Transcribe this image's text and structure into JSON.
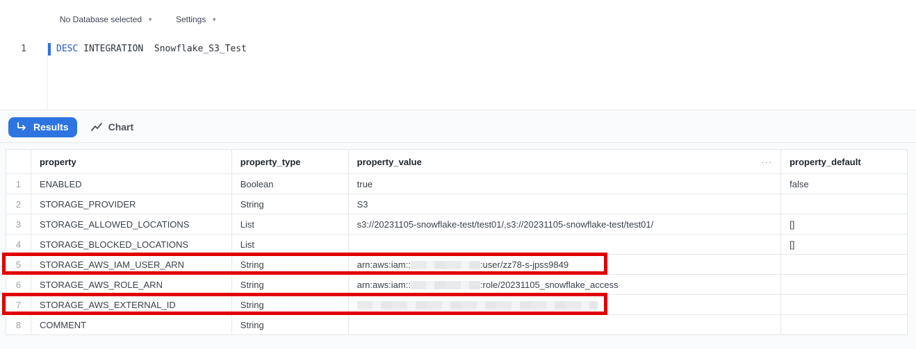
{
  "toolbar": {
    "database_label": "No Database selected",
    "settings_label": "Settings"
  },
  "editor": {
    "line_number": "1",
    "keyword": "DESC",
    "statement": " INTEGRATION  Snowflake_S3_Test"
  },
  "results": {
    "tabs": {
      "results_label": "Results",
      "chart_label": "Chart"
    },
    "columns": [
      "property",
      "property_type",
      "property_value",
      "property_default"
    ],
    "more_icon": "···",
    "rows": [
      {
        "num": "1",
        "property": "ENABLED",
        "type": "Boolean",
        "value": "true",
        "default": "false"
      },
      {
        "num": "2",
        "property": "STORAGE_PROVIDER",
        "type": "String",
        "value": "S3",
        "default": ""
      },
      {
        "num": "3",
        "property": "STORAGE_ALLOWED_LOCATIONS",
        "type": "List",
        "value": "s3://20231105-snowflake-test/test01/,s3://20231105-snowflake-test/test01/",
        "default": "[]"
      },
      {
        "num": "4",
        "property": "STORAGE_BLOCKED_LOCATIONS",
        "type": "List",
        "value": "",
        "default": "[]"
      },
      {
        "num": "5",
        "property": "STORAGE_AWS_IAM_USER_ARN",
        "type": "String",
        "value_prefix": "arn:aws:iam::",
        "value_suffix": ":user/zz78-s-jpss9849",
        "default": ""
      },
      {
        "num": "6",
        "property": "STORAGE_AWS_ROLE_ARN",
        "type": "String",
        "value_prefix": "arn:aws:iam::",
        "value_suffix": ":role/20231105_snowflake_access",
        "default": ""
      },
      {
        "num": "7",
        "property": "STORAGE_AWS_EXTERNAL_ID",
        "type": "String",
        "value": "",
        "default": ""
      },
      {
        "num": "8",
        "property": "COMMENT",
        "type": "String",
        "value": "",
        "default": ""
      }
    ]
  },
  "colors": {
    "accent": "#2d74e0",
    "highlight": "#e00000"
  },
  "icons": {
    "database_caret": "chevron-down-icon",
    "results_tab": "return-arrow-icon",
    "chart_tab": "trend-line-icon"
  }
}
